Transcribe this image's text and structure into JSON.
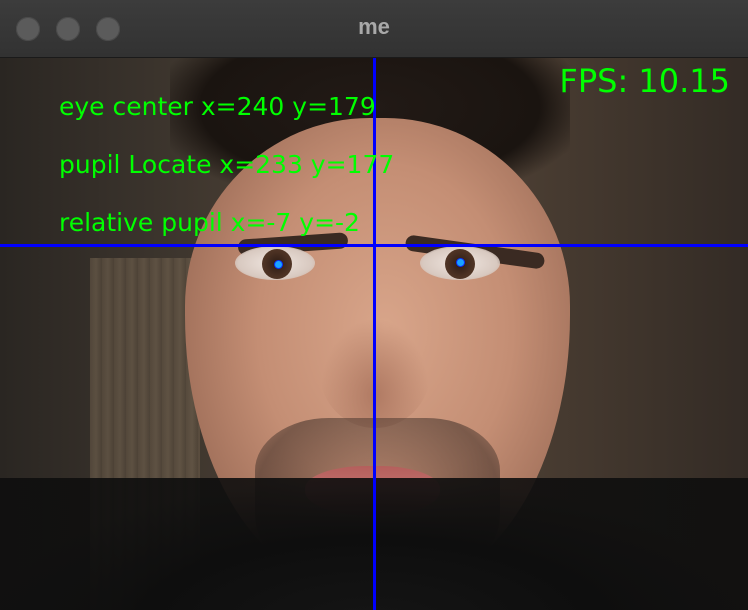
{
  "window": {
    "title": "me"
  },
  "overlay": {
    "fps": "FPS: 10.15",
    "eye_center": "eye center x=240 y=179",
    "pupil_locate": "pupil Locate x=233 y=177",
    "relative_pupil": "relative pupil x=-7 y=-2"
  },
  "colors": {
    "overlay_text": "#00ff00",
    "crosshair": "#0000ff",
    "pupil_marker": "#1aa3ff"
  }
}
